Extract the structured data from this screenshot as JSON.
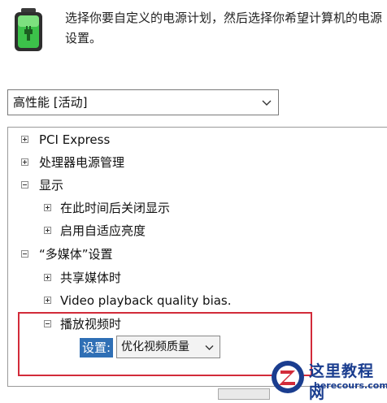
{
  "header": {
    "description": "选择你要自定义的电源计划，然后选择你希望计算机的电源设置。",
    "icon": "battery-plug-icon"
  },
  "plan_select": {
    "value": "高性能 [活动]"
  },
  "tree": {
    "items": [
      {
        "label": "PCI Express",
        "state": "collapsed"
      },
      {
        "label": "处理器电源管理",
        "state": "collapsed"
      },
      {
        "label": "显示",
        "state": "expanded"
      },
      {
        "label": "在此时间后关闭显示",
        "state": "collapsed"
      },
      {
        "label": "启用自适应亮度",
        "state": "collapsed"
      },
      {
        "label": "“多媒体”设置",
        "state": "expanded"
      },
      {
        "label": "共享媒体时",
        "state": "collapsed"
      },
      {
        "label": "Video playback quality bias.",
        "state": "collapsed"
      },
      {
        "label": "播放视频时",
        "state": "expanded"
      }
    ]
  },
  "setting": {
    "label": "设置:",
    "value": "优化视频质量"
  },
  "watermark": {
    "title": "这里教程网",
    "url": "herecours.com"
  },
  "colors": {
    "highlight_border": "#d22b3a",
    "selection": "#2f6fb5"
  }
}
